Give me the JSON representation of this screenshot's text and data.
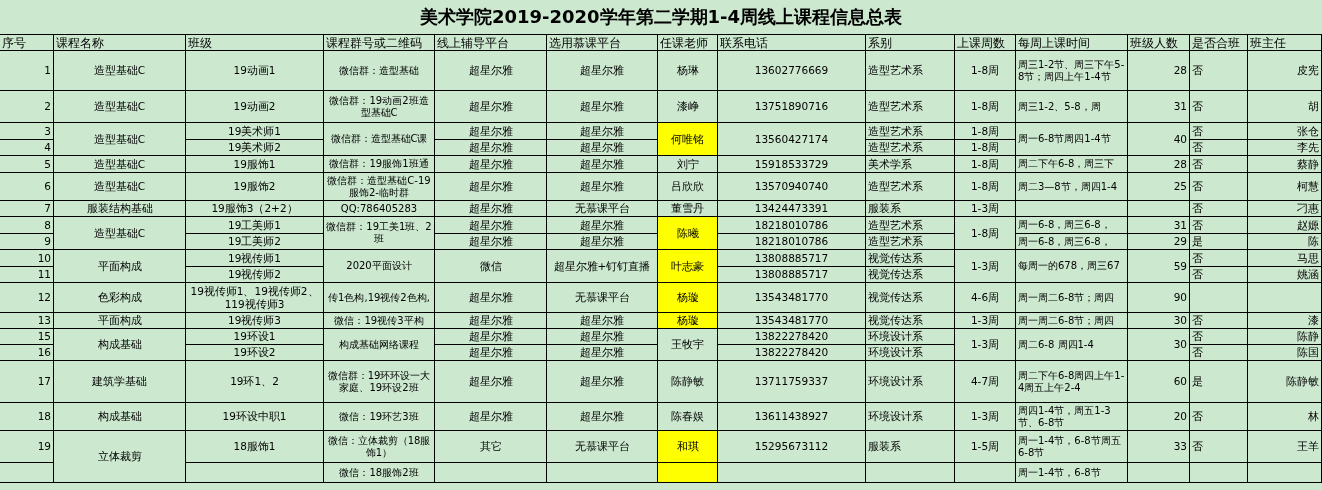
{
  "title": "美术学院2019-2020学年第二学期1-4周线上课程信息总表",
  "columns": [
    "序号",
    "课程名称",
    "班级",
    "课程群号或二维码",
    "线上辅导平台",
    "选用慕课平台",
    "任课老师",
    "联系电话",
    "系别",
    "上课周数",
    "每周上课时间",
    "班级人数",
    "是否合班",
    "班主任"
  ],
  "rows": [
    {
      "cells": [
        {
          "text": "1"
        },
        {
          "text": "造型基础C"
        },
        {
          "text": "19动画1"
        },
        {
          "text": "微信群：造型基础"
        },
        {
          "text": "超星尔雅"
        },
        {
          "text": "超星尔雅"
        },
        {
          "text": "杨琳",
          "highlighted": false
        },
        {
          "text": "13602776669"
        },
        {
          "text": "造型艺术系"
        },
        {
          "text": "1-8周"
        },
        {
          "text": "周三1-2节、周三下午5-8节；周四上午1-4节"
        },
        {
          "text": "28"
        },
        {
          "text": "否"
        },
        {
          "text": "皮宪"
        }
      ]
    },
    {
      "cells": [
        {
          "text": "2"
        },
        {
          "text": "造型基础C"
        },
        {
          "text": "19动画2"
        },
        {
          "text": "微信群：19动画2班造型基础C"
        },
        {
          "text": "超星尔雅"
        },
        {
          "text": "超星尔雅"
        },
        {
          "text": "漆峥",
          "highlighted": false
        },
        {
          "text": "13751890716"
        },
        {
          "text": "造型艺术系"
        },
        {
          "text": "1-8周"
        },
        {
          "text": "周三1-2、5-8，周"
        },
        {
          "text": "31"
        },
        {
          "text": "否"
        },
        {
          "text": "胡"
        }
      ]
    },
    {
      "cells": [
        {
          "text": "3"
        },
        {
          "text": "造型基础C",
          "merged_down": true
        },
        {
          "text": "19美术师1"
        },
        {
          "text": "微信群：造型基础C课",
          "merged_down": true
        },
        {
          "text": "超星尔雅"
        },
        {
          "text": "超星尔雅"
        },
        {
          "text": "何唯铭",
          "highlighted": true,
          "merged_down": true
        },
        {
          "text": "13560427174",
          "merged_down": true
        },
        {
          "text": "造型艺术系"
        },
        {
          "text": "1-8周"
        },
        {
          "text": "周一6-8节周四1-4节",
          "merged_down": true
        },
        {
          "text": "40",
          "merged_down": true
        },
        {
          "text": "否"
        },
        {
          "text": "张仓"
        }
      ]
    },
    {
      "cells": [
        {
          "text": "4"
        },
        {
          "text": "19美术师2"
        },
        {
          "text": "超星尔雅"
        },
        {
          "text": "超星尔雅"
        },
        {
          "text": "造型艺术系"
        },
        {
          "text": "1-8周"
        },
        {
          "text": "否"
        },
        {
          "text": "李先"
        }
      ]
    },
    {
      "cells": [
        {
          "text": "5"
        },
        {
          "text": "造型基础C"
        },
        {
          "text": "19服饰1"
        },
        {
          "text": "微信群：19服饰1班通"
        },
        {
          "text": "超星尔雅"
        },
        {
          "text": "超星尔雅"
        },
        {
          "text": "刘宁",
          "highlighted": false
        },
        {
          "text": "15918533729"
        },
        {
          "text": "美术学系"
        },
        {
          "text": "1-8周"
        },
        {
          "text": "周二下午6-8，周三下"
        },
        {
          "text": "28"
        },
        {
          "text": "否"
        },
        {
          "text": "蔡静"
        }
      ]
    },
    {
      "cells": [
        {
          "text": "6"
        },
        {
          "text": "造型基础C"
        },
        {
          "text": "19服饰2"
        },
        {
          "text": "微信群：造型基础C-19服饰2-临时群"
        },
        {
          "text": "超星尔雅"
        },
        {
          "text": "超星尔雅"
        },
        {
          "text": "吕欣欣",
          "highlighted": false
        },
        {
          "text": "13570940740"
        },
        {
          "text": "造型艺术系"
        },
        {
          "text": "1-8周"
        },
        {
          "text": "周二3—8节，周四1-4"
        },
        {
          "text": "25"
        },
        {
          "text": "否"
        },
        {
          "text": "柯慧"
        }
      ]
    },
    {
      "cells": [
        {
          "text": "7"
        },
        {
          "text": "服装结构基础"
        },
        {
          "text": "19服饰3（2+2）"
        },
        {
          "text": "QQ:786405283"
        },
        {
          "text": "超星尔雅"
        },
        {
          "text": "无慕课平台"
        },
        {
          "text": "董雪丹",
          "highlighted": false
        },
        {
          "text": "13424473391"
        },
        {
          "text": "服装系"
        },
        {
          "text": "1-3周"
        },
        {},
        {},
        {
          "text": "否"
        },
        {
          "text": "刁惠"
        }
      ]
    },
    {
      "cells": [
        {
          "text": "8"
        },
        {
          "text": "造型基础C",
          "merged_down": true
        },
        {
          "text": "19工美师1"
        },
        {
          "text": "微信群：19工美1班、2班",
          "merged_down": true
        },
        {
          "text": "超星尔雅"
        },
        {
          "text": "超星尔雅"
        },
        {
          "text": "陈曦",
          "highlighted": true,
          "merged_down": true
        },
        {
          "text": "18218010786"
        },
        {
          "text": "造型艺术系"
        },
        {
          "text": "1-8周",
          "merged_down": true
        },
        {
          "text": "周一6-8，周三6-8，"
        },
        {
          "text": "31"
        },
        {
          "text": "否"
        },
        {
          "text": "赵嫄"
        }
      ]
    },
    {
      "cells": [
        {
          "text": "9"
        },
        {
          "text": "19工美师2"
        },
        {
          "text": "超星尔雅"
        },
        {
          "text": "超星尔雅"
        },
        {
          "text": "18218010786"
        },
        {
          "text": "造型艺术系"
        },
        {
          "text": "周一6-8，周三6-8，"
        },
        {
          "text": "29"
        },
        {
          "text": "是"
        },
        {
          "text": "陈"
        }
      ]
    },
    {
      "cells": [
        {
          "text": "10"
        },
        {
          "text": "平面构成",
          "merged_down": true
        },
        {
          "text": "19视传师1"
        },
        {
          "text": "2020平面设计",
          "merged_down": true
        },
        {
          "text": "微信",
          "merged_down": true
        },
        {
          "text": "超星尔雅+钉钉直播",
          "merged_down": true
        },
        {
          "text": "叶志豪",
          "highlighted": true,
          "merged_down": true
        },
        {
          "text": "13808885717"
        },
        {
          "text": "视觉传达系"
        },
        {
          "text": "1-3周",
          "merged_down": true
        },
        {
          "text": "每周一的678，周三67",
          "merged_down": true
        },
        {
          "text": "59",
          "merged_down": true
        },
        {
          "text": "否"
        },
        {
          "text": "马思"
        }
      ]
    },
    {
      "cells": [
        {
          "text": "11"
        },
        {
          "text": "19视传师2"
        },
        {
          "text": "13808885717"
        },
        {
          "text": "视觉传达系"
        },
        {
          "text": "否"
        },
        {
          "text": "姚涵"
        }
      ]
    },
    {
      "cells": [
        {
          "text": "12"
        },
        {
          "text": "色彩构成"
        },
        {
          "text": "19视传师1、19视传师2、119视传师3"
        },
        {
          "text": "传1色构,19视传2色构,"
        },
        {
          "text": "超星尔雅"
        },
        {
          "text": "无慕课平台"
        },
        {
          "text": "杨璇",
          "highlighted": true
        },
        {
          "text": "13543481770"
        },
        {
          "text": "视觉传达系"
        },
        {
          "text": "4-6周"
        },
        {
          "text": "周一周二6-8节；周四"
        },
        {
          "text": "90"
        },
        {},
        {}
      ]
    },
    {
      "cells": [
        {
          "text": "13"
        },
        {
          "text": "平面构成"
        },
        {
          "text": "19视传师3"
        },
        {
          "text": "微信：19视传3平构"
        },
        {
          "text": "超星尔雅"
        },
        {
          "text": "超星尔雅"
        },
        {
          "text": "杨璇",
          "highlighted": true
        },
        {
          "text": "13543481770"
        },
        {
          "text": "视觉传达系"
        },
        {
          "text": "1-3周"
        },
        {
          "text": "周一周二6-8节；周四"
        },
        {
          "text": "30"
        },
        {
          "text": "否"
        },
        {
          "text": "漆"
        }
      ]
    },
    {
      "cells": [
        {
          "text": "15"
        },
        {
          "text": "构成基础",
          "merged_down": true
        },
        {
          "text": "19环设1"
        },
        {
          "text": "构成基础网络课程",
          "merged_down": true
        },
        {
          "text": "超星尔雅"
        },
        {
          "text": "超星尔雅"
        },
        {
          "text": "王牧宇",
          "highlighted": false,
          "merged_down": true
        },
        {
          "text": "13822278420"
        },
        {
          "text": "环境设计系"
        },
        {
          "text": "1-3周",
          "merged_down": true
        },
        {
          "text": "周二6-8 周四1-4",
          "merged_down": true
        },
        {
          "text": "30",
          "merged_down": true
        },
        {
          "text": "否"
        },
        {
          "text": "陈静"
        }
      ]
    },
    {
      "cells": [
        {
          "text": "16"
        },
        {
          "text": "19环设2"
        },
        {
          "text": "超星尔雅"
        },
        {
          "text": "超星尔雅"
        },
        {
          "text": "13822278420"
        },
        {
          "text": "环境设计系"
        },
        {
          "text": "否"
        },
        {
          "text": "陈国"
        }
      ]
    },
    {
      "cells": [
        {
          "text": "17"
        },
        {
          "text": "建筑学基础"
        },
        {
          "text": "19环1、2"
        },
        {
          "text": "微信群：19环环设一大家庭、19环设2班"
        },
        {
          "text": "超星尔雅"
        },
        {
          "text": "超星尔雅"
        },
        {
          "text": "陈静敏",
          "highlighted": false
        },
        {
          "text": "13711759337"
        },
        {
          "text": "环境设计系"
        },
        {
          "text": "4-7周"
        },
        {
          "text": "周二下午6-8周四上午1-4周五上午2-4"
        },
        {
          "text": "60"
        },
        {
          "text": "是"
        },
        {
          "text": "陈静敏"
        }
      ]
    },
    {
      "cells": [
        {
          "text": "18"
        },
        {
          "text": "构成基础"
        },
        {
          "text": "19环设中职1"
        },
        {
          "text": "微信：19环艺3班"
        },
        {
          "text": "超星尔雅"
        },
        {
          "text": "超星尔雅"
        },
        {
          "text": "陈春娱",
          "highlighted": false
        },
        {
          "text": "13611438927"
        },
        {
          "text": "环境设计系"
        },
        {
          "text": "1-3周"
        },
        {
          "text": "周四1-4节，周五1-3节、6-8节"
        },
        {
          "text": "20"
        },
        {
          "text": "否"
        },
        {
          "text": "林"
        }
      ]
    },
    {
      "cells": [
        {
          "text": "19"
        },
        {
          "text": "立体裁剪",
          "merged_down": true
        },
        {
          "text": "18服饰1"
        },
        {
          "text": "微信：立体裁剪（18服饰1）"
        },
        {
          "text": "其它"
        },
        {
          "text": "无慕课平台"
        },
        {
          "text": "和琪",
          "highlighted": true
        },
        {
          "text": "15295673112"
        },
        {
          "text": "服装系"
        },
        {
          "text": "1-5周"
        },
        {
          "text": "周一1-4节，6-8节周五6-8节"
        },
        {
          "text": "33"
        },
        {
          "text": "否"
        },
        {
          "text": "王羊"
        }
      ]
    },
    {
      "cells": [
        {},
        {},
        {
          "text": "微信：18服饰2班"
        },
        {},
        {},
        {
          "highlighted": true
        },
        {},
        {},
        {},
        {
          "text": "周一1-4节，6-8节"
        },
        {},
        {},
        {}
      ]
    }
  ]
}
